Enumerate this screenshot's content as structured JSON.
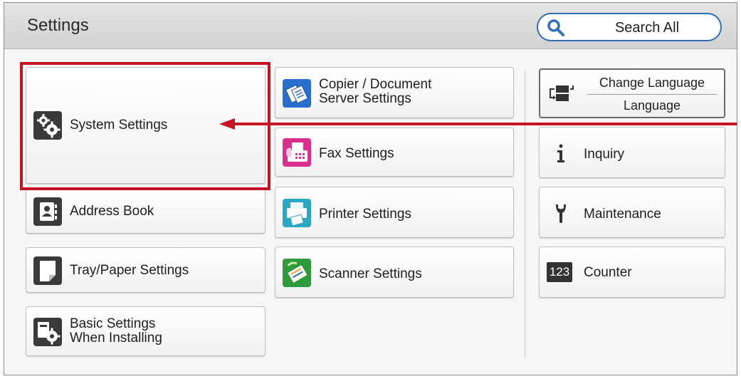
{
  "header": {
    "title": "Settings",
    "search_label": "Search All"
  },
  "left_column": {
    "system_settings": "System Settings",
    "address_book": "Address Book",
    "tray_paper": "Tray/Paper Settings",
    "basic_settings": "Basic Settings\nWhen Installing"
  },
  "middle_column": {
    "copier": "Copier / Document\nServer Settings",
    "fax": "Fax Settings",
    "printer": "Printer Settings",
    "scanner": "Scanner Settings"
  },
  "right_column": {
    "change_language": "Change Language",
    "language": "Language",
    "inquiry": "Inquiry",
    "maintenance": "Maintenance",
    "counter": "Counter",
    "counter_icon_text": "123"
  },
  "icons": {
    "system_settings": "gears-icon",
    "address_book": "address-book-icon",
    "tray_paper": "paper-icon",
    "basic_settings": "basic-settings-icon",
    "copier": "copier-icon",
    "fax": "fax-icon",
    "printer": "printer-icon",
    "scanner": "scanner-icon",
    "change_language": "language-switch-icon",
    "inquiry": "info-icon",
    "maintenance": "wrench-icon",
    "counter": "counter-icon"
  },
  "colors": {
    "highlight": "#c41426",
    "search_border": "#2f6fb8",
    "copier_icon": "#2a6fd0",
    "fax_icon": "#d9308e",
    "printer_icon": "#2aa7c4",
    "scanner_icon": "#2f9a3b"
  }
}
